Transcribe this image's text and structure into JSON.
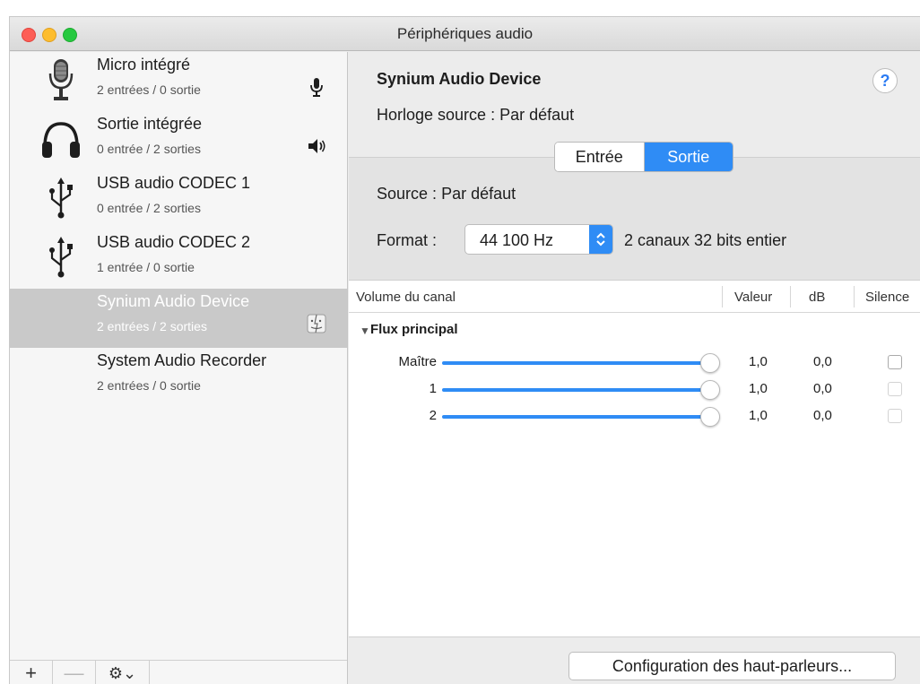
{
  "window": {
    "title": "Périphériques audio"
  },
  "devices": [
    {
      "name": "Micro intégré",
      "sub": "2 entrées / 0 sortie",
      "icon": "microphone-icon",
      "badge": "microphone-badge-icon"
    },
    {
      "name": "Sortie intégrée",
      "sub": "0 entrée / 2 sorties",
      "icon": "headphones-icon",
      "badge": "speaker-badge-icon"
    },
    {
      "name": "USB audio CODEC 1",
      "sub": "0 entrée / 2 sorties",
      "icon": "usb-icon"
    },
    {
      "name": "USB audio CODEC 2",
      "sub": "1 entrée / 0 sortie",
      "icon": "usb-icon"
    },
    {
      "name": "Synium Audio Device",
      "sub": "2 entrées / 2 sorties",
      "icon": "none",
      "badge": "finder-badge-icon",
      "selected": true
    },
    {
      "name": "System Audio Recorder",
      "sub": "2 entrées / 0 sortie",
      "icon": "none"
    }
  ],
  "sidebar_buttons": {
    "add": "+",
    "remove": "—",
    "gear": "⚙︎⌄"
  },
  "detail": {
    "title": "Synium Audio Device",
    "help": "?",
    "clock_label": "Horloge source :",
    "clock_value": "Par défaut",
    "tabs": {
      "input": "Entrée",
      "output": "Sortie",
      "selected": "output"
    },
    "source_label": "Source :",
    "source_value": "Par défaut",
    "format_label": "Format :",
    "format_value": "44 100 Hz",
    "format_desc": "2 canaux 32 bits entier"
  },
  "table": {
    "headers": {
      "channel": "Volume du canal",
      "value": "Valeur",
      "db": "dB",
      "mute": "Silence"
    },
    "group": "Flux principal",
    "rows": [
      {
        "label": "Maître",
        "level": 1.0,
        "value": "1,0",
        "db": "0,0",
        "muted": false,
        "enabled": true
      },
      {
        "label": "1",
        "level": 1.0,
        "value": "1,0",
        "db": "0,0",
        "muted": false,
        "enabled": false
      },
      {
        "label": "2",
        "level": 1.0,
        "value": "1,0",
        "db": "0,0",
        "muted": false,
        "enabled": false
      }
    ]
  },
  "footer": {
    "configure_button": "Configuration des haut-parleurs..."
  },
  "colors": {
    "accent": "#2f8cf5",
    "selection": "#c9c9c9",
    "close": "#fd5e56",
    "minimize": "#fdbd2e",
    "maximize": "#26c940"
  }
}
